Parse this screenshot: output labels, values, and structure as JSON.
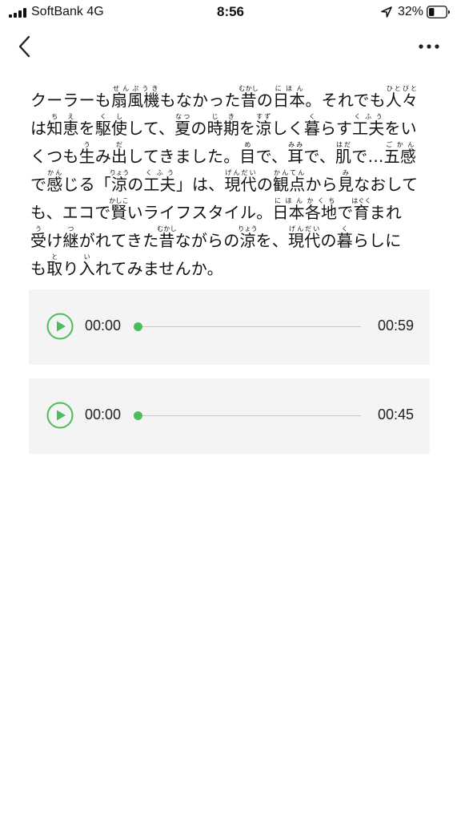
{
  "status_bar": {
    "carrier": "SoftBank  4G",
    "time": "8:56",
    "battery_percent": "32%",
    "battery_level": 0.32
  },
  "nav": {
    "back_icon": "chevron-left-icon",
    "more_icon": "ellipsis-icon"
  },
  "article": {
    "lines": [
      [
        [
          "クーラーも",
          ""
        ],
        [
          "扇風機",
          "せんぷうき"
        ],
        [
          "もなかった",
          ""
        ],
        [
          "昔",
          "むかし"
        ],
        [
          "の",
          ""
        ],
        [
          "日本",
          "にほん"
        ],
        [
          "。それでも",
          ""
        ],
        [
          "人々",
          "ひとびと"
        ]
      ],
      [
        [
          "は",
          ""
        ],
        [
          "知恵",
          "ちえ"
        ],
        [
          "を",
          ""
        ],
        [
          "駆使",
          "くし"
        ],
        [
          "して、",
          ""
        ],
        [
          "夏",
          "なつ"
        ],
        [
          "の",
          ""
        ],
        [
          "時期",
          "じき"
        ],
        [
          "を",
          ""
        ],
        [
          "涼",
          "すず"
        ],
        [
          "しく",
          ""
        ],
        [
          "暮",
          "く"
        ],
        [
          "らす",
          ""
        ],
        [
          "工夫",
          "くふう"
        ],
        [
          "をい",
          ""
        ]
      ],
      [
        [
          "くつも",
          ""
        ],
        [
          "生",
          "う"
        ],
        [
          "み",
          ""
        ],
        [
          "出",
          "だ"
        ],
        [
          "してきました。",
          ""
        ],
        [
          "目",
          "め"
        ],
        [
          "で、",
          ""
        ],
        [
          "耳",
          "みみ"
        ],
        [
          "で、",
          ""
        ],
        [
          "肌",
          "はだ"
        ],
        [
          "で…",
          ""
        ],
        [
          "五感",
          "ごかん"
        ]
      ],
      [
        [
          "で",
          ""
        ],
        [
          "感",
          "かん"
        ],
        [
          "じる「",
          ""
        ],
        [
          "涼",
          "りょう"
        ],
        [
          "の",
          ""
        ],
        [
          "工夫",
          "くふう"
        ],
        [
          "」は、",
          ""
        ],
        [
          "現代",
          "げんだい"
        ],
        [
          "の",
          ""
        ],
        [
          "観点",
          "かんてん"
        ],
        [
          "から",
          ""
        ],
        [
          "見",
          "み"
        ],
        [
          "なおして",
          ""
        ]
      ],
      [
        [
          "も、エコで",
          ""
        ],
        [
          "賢",
          "かしこ"
        ],
        [
          "いライフスタイル。",
          ""
        ],
        [
          "日本",
          "にほん"
        ],
        [
          "各地",
          "かくち"
        ],
        [
          "で",
          ""
        ],
        [
          "育",
          "はぐく"
        ],
        [
          "まれ",
          ""
        ]
      ],
      [
        [
          "受",
          "う"
        ],
        [
          "け",
          ""
        ],
        [
          "継",
          "つ"
        ],
        [
          "がれてきた",
          ""
        ],
        [
          "昔",
          "むかし"
        ],
        [
          "ながらの",
          ""
        ],
        [
          "涼",
          "りょう"
        ],
        [
          "を、",
          ""
        ],
        [
          "現代",
          "げんだい"
        ],
        [
          "の",
          ""
        ],
        [
          "暮",
          "く"
        ],
        [
          "らしに",
          ""
        ]
      ],
      [
        [
          "も",
          ""
        ],
        [
          "取",
          "と"
        ],
        [
          "り",
          ""
        ],
        [
          "入",
          "い"
        ],
        [
          "れてみませんか。",
          ""
        ]
      ]
    ]
  },
  "players": [
    {
      "current_time": "00:00",
      "duration": "00:59",
      "progress": 0,
      "play_icon": "play-icon"
    },
    {
      "current_time": "00:00",
      "duration": "00:45",
      "progress": 0,
      "play_icon": "play-icon"
    }
  ],
  "colors": {
    "accent_green": "#4cbd5c",
    "player_bg": "#f4f4f4"
  }
}
